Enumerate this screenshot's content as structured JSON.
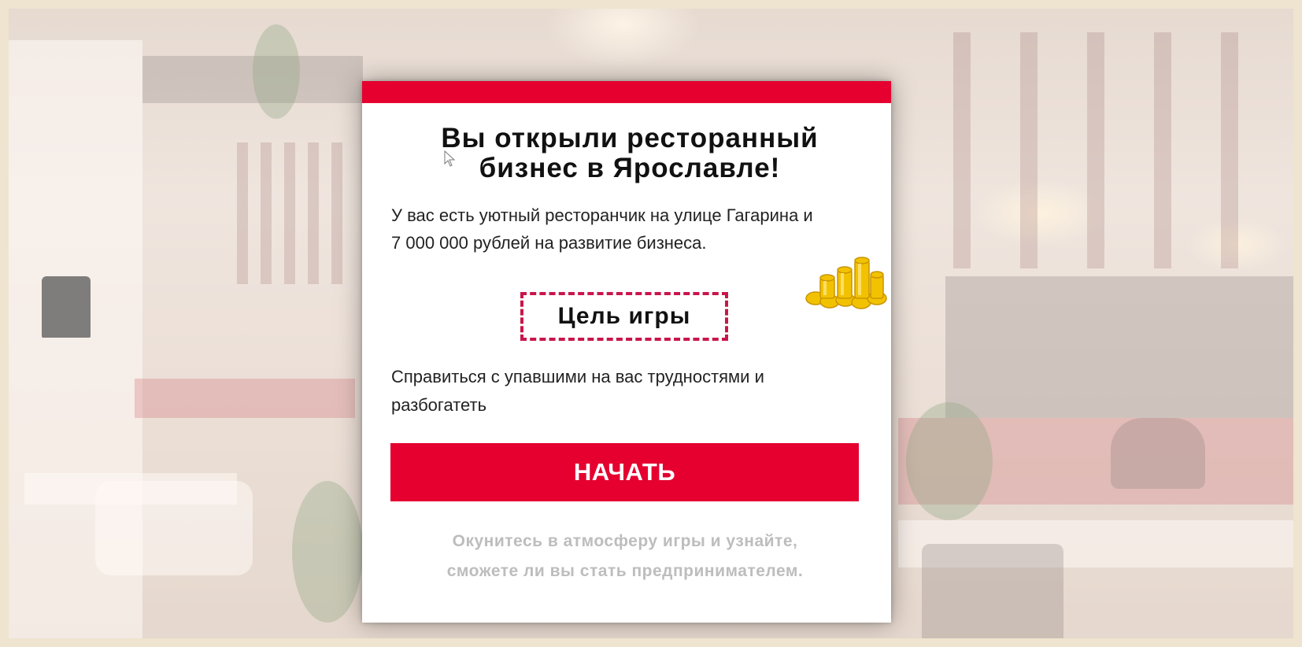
{
  "card": {
    "title": "Вы открыли ресторанный\nбизнес в Ярославле!",
    "intro": "У вас есть уютный ресторанчик на улице Гагарина и 7 000 000 рублей на развитие бизнеса.",
    "goal_label": "Цель игры",
    "goal_text": "Справиться с упавшими на вас трудностями и разбогатеть",
    "start_button": "НАЧАТЬ",
    "footer": "Окунитесь в атмосферу игры и узнайте,\nсможете ли вы стать предпринимателем."
  },
  "colors": {
    "accent": "#e50030",
    "goal_border": "#c8164b",
    "muted_text": "#bdbdbd"
  },
  "icons": {
    "cursor": "mouse-pointer-icon",
    "coins": "gold-coins-icon"
  }
}
